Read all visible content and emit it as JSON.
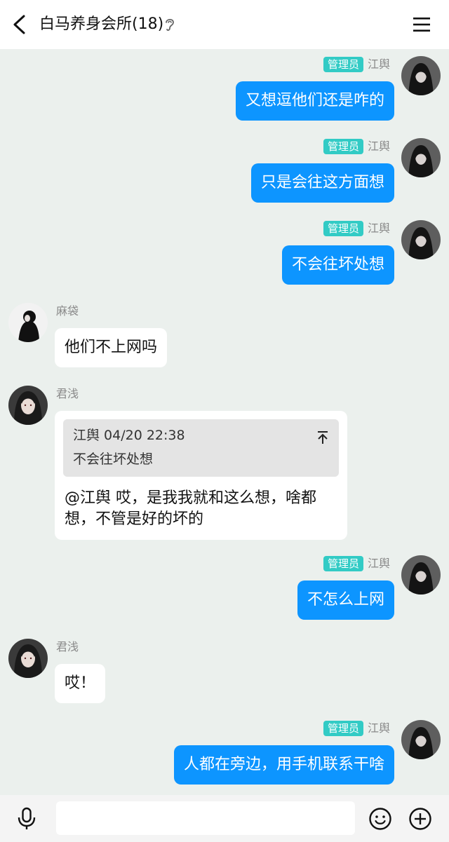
{
  "header": {
    "title": "白马养身会所(18)"
  },
  "messages": [
    {
      "side": "right",
      "badge": "管理员",
      "sender": "江舆",
      "text": "又想逗他们还是咋的"
    },
    {
      "side": "right",
      "badge": "管理员",
      "sender": "江舆",
      "text": "只是会往这方面想"
    },
    {
      "side": "right",
      "badge": "管理员",
      "sender": "江舆",
      "text": "不会往坏处想"
    },
    {
      "side": "left",
      "sender": "麻袋",
      "text": "他们不上网吗"
    },
    {
      "side": "left",
      "sender": "君浅",
      "quote": {
        "header": "江舆 04/20 22:38",
        "text": "不会往坏处想"
      },
      "text": "@江舆 哎，是我我就和这么想，啥都想，不管是好的坏的"
    },
    {
      "side": "right",
      "badge": "管理员",
      "sender": "江舆",
      "text": "不怎么上网"
    },
    {
      "side": "left",
      "sender": "君浅",
      "text": "哎！"
    },
    {
      "side": "right",
      "badge": "管理员",
      "sender": "江舆",
      "text": "人都在旁边，用手机联系干啥"
    }
  ],
  "input": {
    "value": ""
  },
  "colors": {
    "background": "#ebf0ed",
    "own_bubble": "#0d95ff",
    "admin_badge": "#32cbc5"
  },
  "icons": [
    "back-arrow-icon",
    "ear-icon",
    "menu-icon",
    "microphone-icon",
    "emoji-icon",
    "plus-icon"
  ]
}
